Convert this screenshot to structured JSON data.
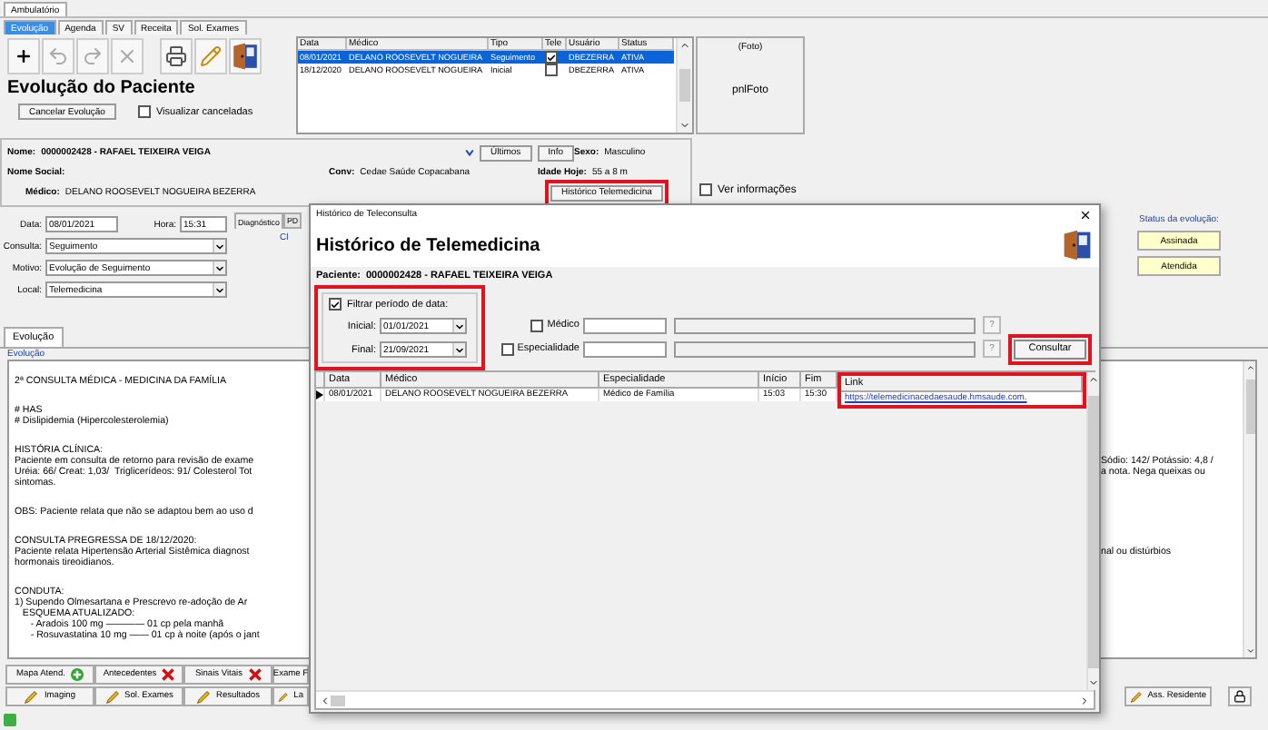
{
  "outer_tab": {
    "label": "Ambulatório"
  },
  "tabs": [
    {
      "label": "Evolução",
      "selected": true
    },
    {
      "label": "Agenda",
      "selected": false
    },
    {
      "label": "SV",
      "selected": false
    },
    {
      "label": "Receita",
      "selected": false
    },
    {
      "label": "Sol. Exames",
      "selected": false
    }
  ],
  "toolbar": [
    {
      "kind": "add",
      "disabled": false
    },
    {
      "kind": "undo",
      "disabled": true
    },
    {
      "kind": "redo",
      "disabled": true
    },
    {
      "kind": "delete",
      "disabled": true
    },
    {
      "kind": "print",
      "disabled": false
    },
    {
      "kind": "edit",
      "disabled": false
    },
    {
      "kind": "exit",
      "disabled": false
    }
  ],
  "title": "Evolução do Paciente",
  "cancel_button": "Cancelar Evolução",
  "show_cancelled": {
    "label": "Visualizar canceladas",
    "checked": false
  },
  "history_grid": {
    "columns": [
      "Data",
      "Médico",
      "Tipo",
      "Tele",
      "Usuário",
      "Status"
    ],
    "rows": [
      {
        "date": "08/01/2021",
        "doctor": "DELANO ROOSEVELT NOGUEIRA",
        "type": "Seguimento",
        "tele": true,
        "user": "DBEZERRA",
        "status": "ATIVA",
        "selected": true
      },
      {
        "date": "18/12/2020",
        "doctor": "DELANO ROOSEVELT NOGUEIRA",
        "type": "Inicial",
        "tele": false,
        "user": "DBEZERRA",
        "status": "ATIVA",
        "selected": false
      }
    ]
  },
  "photo": {
    "caption": "(Foto)",
    "label": "pnlFoto"
  },
  "patient": {
    "name": {
      "label": "Nome:",
      "value": "0000002428 - RAFAEL TEIXEIRA VEIGA"
    },
    "social_name": {
      "label": "Nome Social:"
    },
    "doctor": {
      "label": "Médico:",
      "value": "DELANO ROOSEVELT NOGUEIRA BEZERRA"
    },
    "insurance": {
      "label": "Conv:",
      "value": "Cedae Saúde Copacabana"
    },
    "buttons": [
      "Últimos",
      "Info"
    ],
    "sex": {
      "label": "Sexo:",
      "value": "Masculino"
    },
    "age": {
      "label": "Idade Hoje:",
      "value": "55 a 8 m"
    }
  },
  "telemedicine_button": {
    "label": "Histórico Telemedicina",
    "highlighted": true
  },
  "show_info": {
    "label": "Ver informações",
    "checked": false
  },
  "form": {
    "date": {
      "label": "Data:",
      "value": "08/01/2021"
    },
    "time": {
      "label": "Hora:",
      "value": "15:31"
    },
    "selects": [
      {
        "label": "Consulta:",
        "value": "Seguimento"
      },
      {
        "label": "Motivo:",
        "value": "Evolução de Seguimento"
      },
      {
        "label": "Local:",
        "value": "Telemedicina"
      }
    ]
  },
  "side_tabs": [
    {
      "label": "Diagnóstico",
      "selected": true
    },
    {
      "label": "PD",
      "selected": false
    }
  ],
  "diagnosis_text": "Cl",
  "status": {
    "label": "Status da evolução:",
    "buttons": [
      "Assinada",
      "Atendida"
    ]
  },
  "evolution": {
    "tab": "Evolução",
    "group": "Evolução",
    "lines": [
      {
        "kind": "text",
        "left": "2ª CONSULTA MÉDICA - MEDICINA DA FAMÍLIA"
      },
      {
        "kind": "blank"
      },
      {
        "kind": "text",
        "left": "# HAS"
      },
      {
        "kind": "text",
        "left": "# Dislipidemia (Hipercolesterolemia)"
      },
      {
        "kind": "blank"
      },
      {
        "kind": "text",
        "left": "HISTÓRIA CLÍNICA:"
      },
      {
        "kind": "text",
        "left": "Paciente em consulta de retorno para revisão de exame",
        "right": "Sódio: 142/ Potássio: 4,8 /"
      },
      {
        "kind": "text",
        "left": "Uréia: 66/ Creat: 1,03/  Triglicerídeos: 91/ Colesterol Tot",
        "right": "a nota. Nega queixas ou"
      },
      {
        "kind": "text",
        "left": "sintomas."
      },
      {
        "kind": "blank"
      },
      {
        "kind": "text",
        "left": "OBS: Paciente relata que não se adaptou bem ao uso d"
      },
      {
        "kind": "blank"
      },
      {
        "kind": "text",
        "left": "CONSULTA PREGRESSA DE 18/12/2020:"
      },
      {
        "kind": "text",
        "left": "Paciente relata Hipertensão Arterial Sistêmica diagnost",
        "right": "nal ou distúrbios"
      },
      {
        "kind": "text",
        "left": "hormonais tireoidianos."
      },
      {
        "kind": "blank"
      },
      {
        "kind": "text",
        "left": "CONDUTA:"
      },
      {
        "kind": "text",
        "left": "1) Supendo Olmesartana e Prescrevo re-adoção de Ar"
      },
      {
        "kind": "text",
        "left": "   ESQUEMA ATUALIZADO:"
      },
      {
        "kind": "text",
        "left": "      - Aradois 100 mg ———— 01 cp pela manhã"
      },
      {
        "kind": "text",
        "left": "      - Rosuvastatina 10 mg —— 01 cp à noite (após o jant"
      }
    ]
  },
  "action_rows": [
    [
      {
        "label": "Mapa Atend.",
        "kind": "add"
      },
      {
        "label": "Antecedentes",
        "kind": "remove"
      },
      {
        "label": "Sinais Vitais",
        "kind": "remove"
      },
      {
        "label": "Exame F",
        "kind": "plain"
      }
    ],
    [
      {
        "label": "Imaging",
        "kind": "edit"
      },
      {
        "label": "Sol. Exames",
        "kind": "edit"
      },
      {
        "label": "Resultados",
        "kind": "edit"
      },
      {
        "label": "La",
        "kind": "edit"
      }
    ]
  ],
  "resident_button": {
    "label": "Ass. Residente",
    "kind": "edit"
  },
  "dialog": {
    "title": "Histórico de Teleconsulta",
    "heading": "Histórico de Telemedicina",
    "patient": {
      "label": "Paciente:",
      "value": "0000002428 - RAFAEL TEIXEIRA VEIGA"
    },
    "date_filter": {
      "label": "Filtrar período de data:",
      "checked": true,
      "highlighted": true,
      "start": {
        "label": "Inicial:",
        "value": "01/01/2021"
      },
      "end": {
        "label": "Final:",
        "value": "21/09/2021"
      }
    },
    "filters": [
      {
        "label": "Médico",
        "checked": false,
        "help": "?"
      },
      {
        "label": "Especialidade",
        "checked": false,
        "help": "?"
      }
    ],
    "consult_button": {
      "label": "Consultar",
      "highlighted": true
    },
    "grid": {
      "columns": [
        {
          "label": "Data",
          "highlighted": false
        },
        {
          "label": "Médico",
          "highlighted": false
        },
        {
          "label": "Especialidade",
          "highlighted": false
        },
        {
          "label": "Início",
          "highlighted": false
        },
        {
          "label": "Fim",
          "highlighted": false
        },
        {
          "label": "Link",
          "highlighted": true
        }
      ],
      "rows": [
        {
          "current": true,
          "cells": [
            "08/01/2021",
            "DELANO ROOSEVELT NOGUEIRA BEZERRA",
            "Médico de Família",
            "15:03",
            "15:30",
            "https://telemedicinacedaesaude.hmsaude.com."
          ]
        }
      ]
    }
  }
}
